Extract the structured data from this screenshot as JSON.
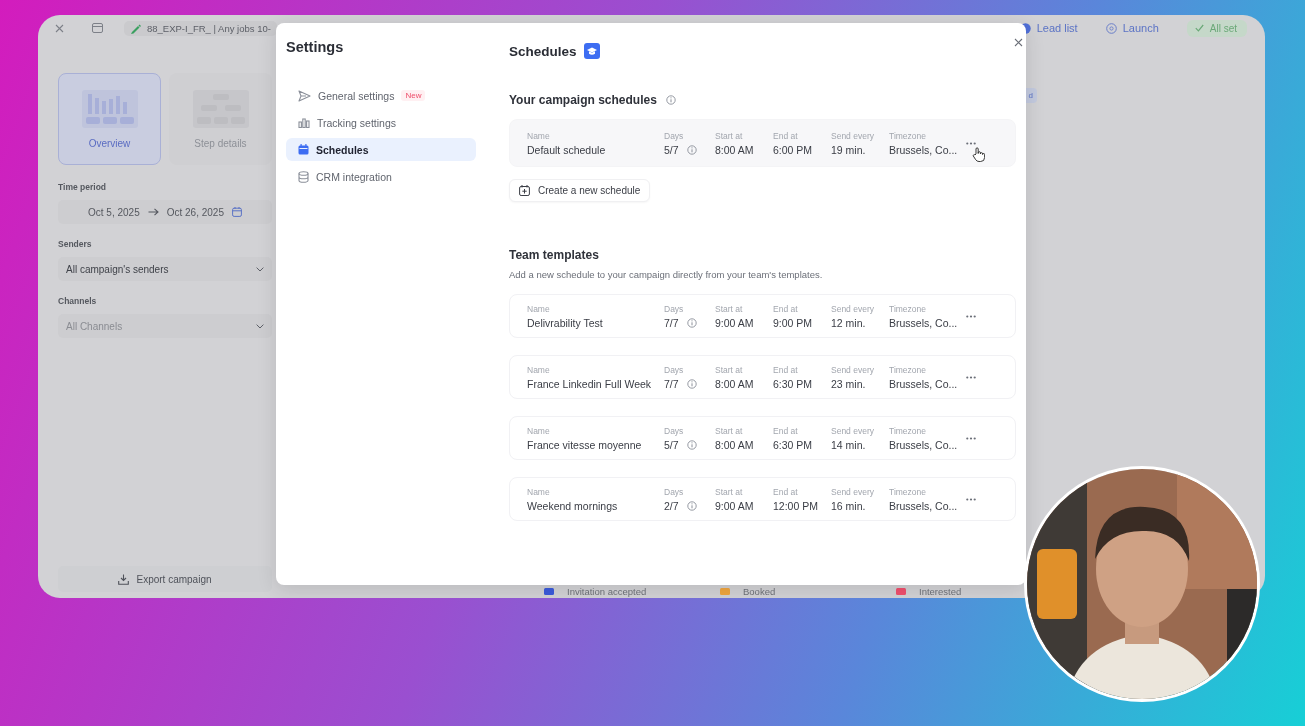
{
  "app": {
    "top_bar": {
      "title": "88_EXP-I_FR_ | Any jobs 10-",
      "steps": [
        {
          "label": "Lead list",
          "kind": "current"
        },
        {
          "label": "Launch",
          "kind": "pending"
        }
      ],
      "status": "All set"
    },
    "views": [
      {
        "label": "Overview",
        "selected": true
      },
      {
        "label": "Step details",
        "selected": false
      }
    ],
    "filters": {
      "time_period": {
        "label": "Time period",
        "start": "Oct 5, 2025",
        "end": "Oct 26, 2025"
      },
      "senders": {
        "label": "Senders",
        "value": "All campaign's senders",
        "disabled": false
      },
      "channels": {
        "label": "Channels",
        "value": "All Channels",
        "disabled": true
      }
    },
    "export_button": "Export campaign",
    "badge": "d",
    "legend": [
      {
        "label": "Invitation accepted",
        "color": "#3b5bdb"
      },
      {
        "label": "Booked",
        "color": "#f0a640"
      },
      {
        "label": "Interested",
        "color": "#f0506e"
      }
    ]
  },
  "settings": {
    "title": "Settings",
    "nav": [
      {
        "label": "General settings",
        "kind": "send",
        "badge": "New",
        "selected": false
      },
      {
        "label": "Tracking settings",
        "kind": "chart",
        "selected": false
      },
      {
        "label": "Schedules",
        "kind": "calendar",
        "selected": true
      },
      {
        "label": "CRM integration",
        "kind": "database",
        "selected": false
      }
    ],
    "heading": "Schedules",
    "campaign_schedules": {
      "title": "Your campaign schedules",
      "rows": [
        {
          "hovered": true,
          "fields": [
            {
              "label": "Name",
              "value": "Default schedule"
            },
            {
              "label": "Days",
              "value": "5/7",
              "info": true
            },
            {
              "label": "Start at",
              "value": "8:00 AM"
            },
            {
              "label": "End at",
              "value": "6:00 PM"
            },
            {
              "label": "Send every",
              "value": "19 min."
            },
            {
              "label": "Timezone",
              "value": "Brussels, Co..."
            }
          ]
        }
      ]
    },
    "create_button": "Create a new schedule",
    "team_templates": {
      "title": "Team templates",
      "description": "Add a new schedule to your campaign directly from your team's templates.",
      "rows": [
        {
          "hovered": false,
          "fields": [
            {
              "label": "Name",
              "value": "Delivrability Test"
            },
            {
              "label": "Days",
              "value": "7/7",
              "info": true
            },
            {
              "label": "Start at",
              "value": "9:00 AM"
            },
            {
              "label": "End at",
              "value": "9:00 PM"
            },
            {
              "label": "Send every",
              "value": "12 min."
            },
            {
              "label": "Timezone",
              "value": "Brussels, Co..."
            }
          ]
        },
        {
          "hovered": false,
          "fields": [
            {
              "label": "Name",
              "value": "France Linkedin Full Week"
            },
            {
              "label": "Days",
              "value": "7/7",
              "info": true
            },
            {
              "label": "Start at",
              "value": "8:00 AM"
            },
            {
              "label": "End at",
              "value": "6:30 PM"
            },
            {
              "label": "Send every",
              "value": "23 min."
            },
            {
              "label": "Timezone",
              "value": "Brussels, Co..."
            }
          ]
        },
        {
          "hovered": false,
          "fields": [
            {
              "label": "Name",
              "value": "France vitesse moyenne"
            },
            {
              "label": "Days",
              "value": "5/7",
              "info": true
            },
            {
              "label": "Start at",
              "value": "8:00 AM"
            },
            {
              "label": "End at",
              "value": "6:30 PM"
            },
            {
              "label": "Send every",
              "value": "14 min."
            },
            {
              "label": "Timezone",
              "value": "Brussels, Co..."
            }
          ]
        },
        {
          "hovered": false,
          "fields": [
            {
              "label": "Name",
              "value": "Weekend mornings"
            },
            {
              "label": "Days",
              "value": "2/7",
              "info": true
            },
            {
              "label": "Start at",
              "value": "9:00 AM"
            },
            {
              "label": "End at",
              "value": "12:00 PM"
            },
            {
              "label": "Send every",
              "value": "16 min."
            },
            {
              "label": "Timezone",
              "value": "Brussels, Co..."
            }
          ]
        }
      ]
    }
  }
}
